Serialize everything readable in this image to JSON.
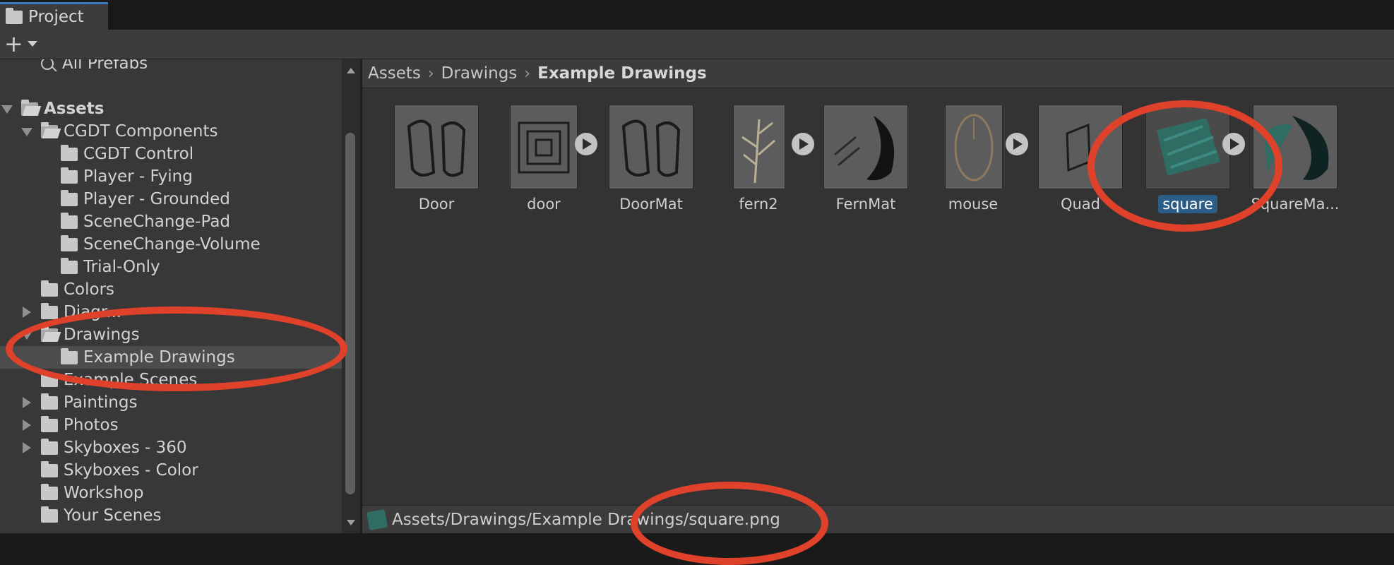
{
  "window": {
    "tab_label": "Project"
  },
  "toolbar": {
    "add_label": "+"
  },
  "tree": {
    "items": [
      {
        "label": "All Prefabs",
        "kind": "search"
      },
      {
        "label": "Assets",
        "kind": "folder-open"
      },
      {
        "label": "CGDT Components",
        "kind": "folder-open"
      },
      {
        "label": "CGDT Control",
        "kind": "folder"
      },
      {
        "label": "Player - Fying",
        "kind": "folder"
      },
      {
        "label": "Player - Grounded",
        "kind": "folder"
      },
      {
        "label": "SceneChange-Pad",
        "kind": "folder"
      },
      {
        "label": "SceneChange-Volume",
        "kind": "folder"
      },
      {
        "label": "Trial-Only",
        "kind": "folder"
      },
      {
        "label": "Colors",
        "kind": "folder"
      },
      {
        "label": "Diagr...",
        "kind": "folder"
      },
      {
        "label": "Drawings",
        "kind": "folder-open"
      },
      {
        "label": "Example Drawings",
        "kind": "folder",
        "selected": true
      },
      {
        "label": "Example Scenes",
        "kind": "folder"
      },
      {
        "label": "Paintings",
        "kind": "folder"
      },
      {
        "label": "Photos",
        "kind": "folder"
      },
      {
        "label": "Skyboxes - 360",
        "kind": "folder"
      },
      {
        "label": "Skyboxes - Color",
        "kind": "folder"
      },
      {
        "label": "Workshop",
        "kind": "folder"
      },
      {
        "label": "Your Scenes",
        "kind": "folder"
      }
    ]
  },
  "breadcrumb": {
    "items": [
      "Assets",
      "Drawings",
      "Example Drawings"
    ]
  },
  "assets": {
    "items": [
      {
        "label": "Door"
      },
      {
        "label": "door"
      },
      {
        "label": "DoorMat"
      },
      {
        "label": "fern2"
      },
      {
        "label": "FernMat"
      },
      {
        "label": "mouse"
      },
      {
        "label": "Quad"
      },
      {
        "label": "square",
        "selected": true
      },
      {
        "label": "SquareMa..."
      }
    ]
  },
  "status": {
    "path": "Assets/Drawings/Example Drawings/square.png"
  },
  "colors": {
    "selection": "#2c5d87",
    "annotation": "#e0412a",
    "tab_accent": "#3a79bb"
  }
}
